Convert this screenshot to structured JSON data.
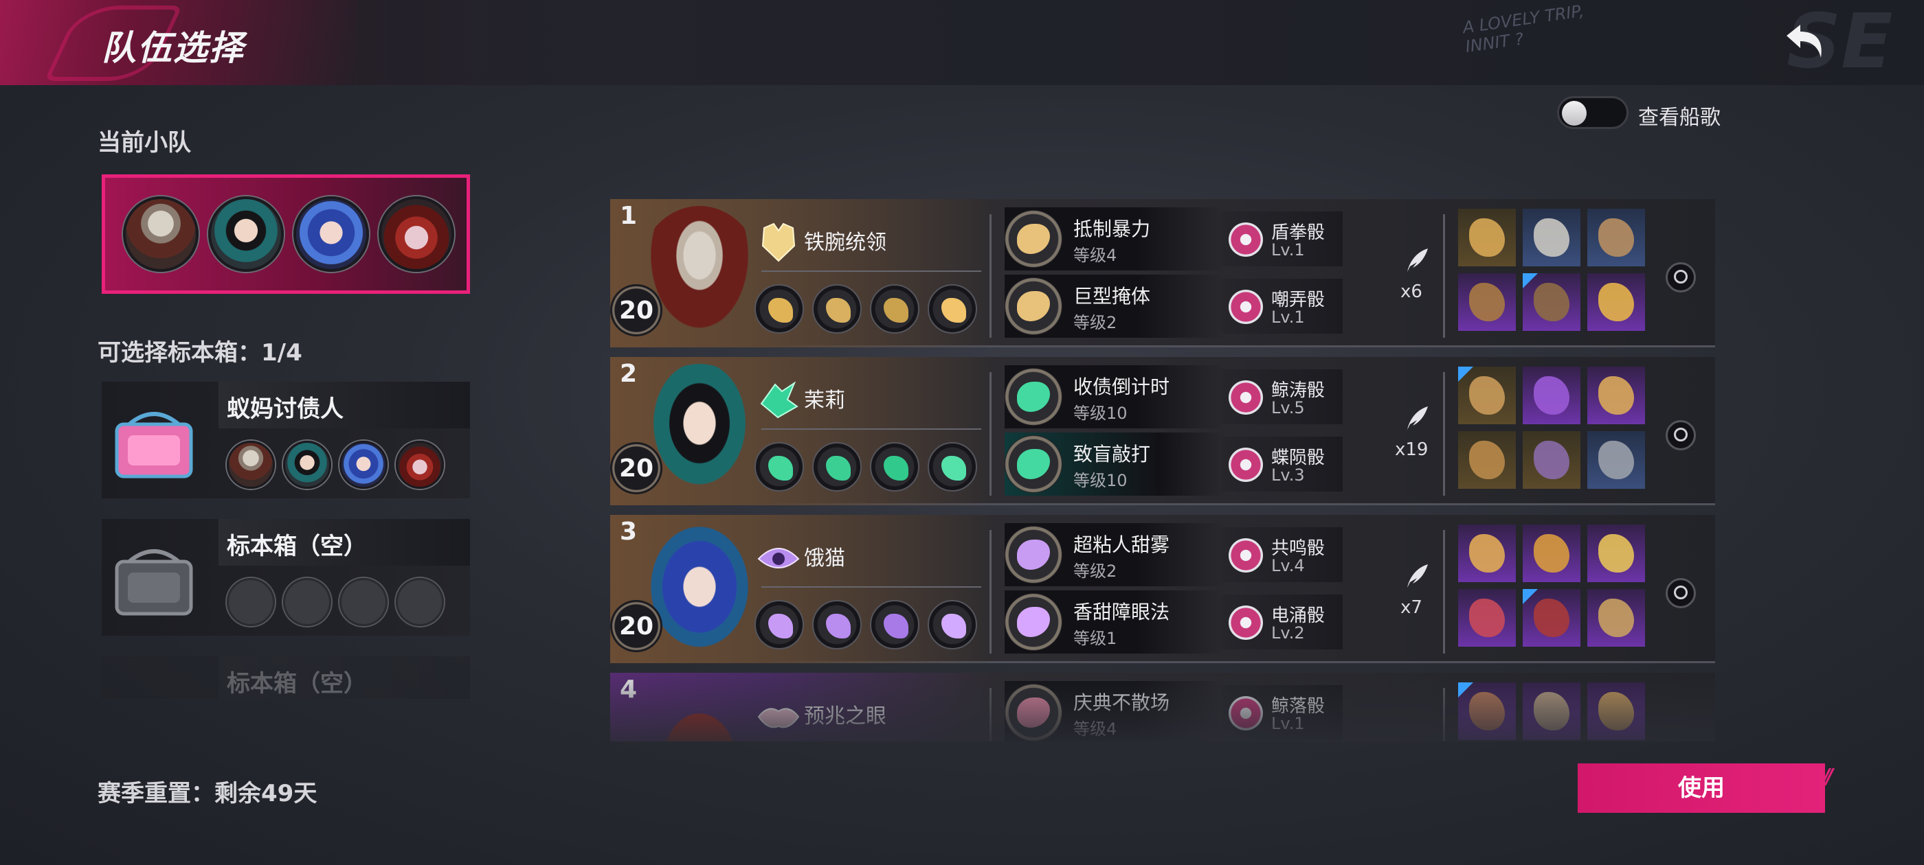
{
  "header": {
    "title": "队伍选择",
    "scribble": "A LOVELY TRIP,\nINNIT ?",
    "watermark": "SE"
  },
  "left": {
    "current_squad_label": "当前小队",
    "selectable_boxes_label": "可选择标本箱：1/4",
    "boxes": [
      {
        "name": "蚁妈讨债人",
        "filled": true
      },
      {
        "name": "标本箱（空）",
        "filled": false
      },
      {
        "name": "标本箱（空）",
        "filled": false
      }
    ],
    "season_reset": "赛季重置：剩余49天"
  },
  "toggle": {
    "label": "查看船歌",
    "on": false
  },
  "roster": [
    {
      "slot": "1",
      "level": "20",
      "name": "铁腕统领",
      "skills": [
        {
          "name": "抵制暴力",
          "level": "等级4",
          "dice": "盾拳骰",
          "dice_level": "Lv.1"
        },
        {
          "name": "巨型掩体",
          "level": "等级2",
          "dice": "嘲弄骰",
          "dice_level": "Lv.1"
        }
      ],
      "feathers": "x6"
    },
    {
      "slot": "2",
      "level": "20",
      "name": "茉莉",
      "skills": [
        {
          "name": "收债倒计时",
          "level": "等级10",
          "dice": "鲸涛骰",
          "dice_level": "Lv.5"
        },
        {
          "name": "致盲敲打",
          "level": "等级10",
          "dice": "蝶陨骰",
          "dice_level": "Lv.3"
        }
      ],
      "feathers": "x19"
    },
    {
      "slot": "3",
      "level": "20",
      "name": "饿猫",
      "skills": [
        {
          "name": "超粘人甜雾",
          "level": "等级2",
          "dice": "共鸣骰",
          "dice_level": "Lv.4"
        },
        {
          "name": "香甜障眼法",
          "level": "等级1",
          "dice": "电涌骰",
          "dice_level": "Lv.2"
        }
      ],
      "feathers": "x7"
    },
    {
      "slot": "4",
      "level": "",
      "name": "预兆之眼",
      "skills": [
        {
          "name": "庆典不散场",
          "level": "等级4",
          "dice": "鲸落骰",
          "dice_level": "Lv.1"
        }
      ],
      "feathers": ""
    }
  ],
  "use_button": "使用",
  "colors": {
    "accent": "#e3227a",
    "header_accent": "#9a1a4e",
    "rarity_gold": "#5b4a2a",
    "rarity_purple": "#6c34a8",
    "rarity_blue": "#3b4f7d"
  },
  "icons": {
    "back": "back-arrow-icon",
    "feather": "feather-icon",
    "inspect": "magnifier-icon",
    "dice": "dice-icon"
  }
}
